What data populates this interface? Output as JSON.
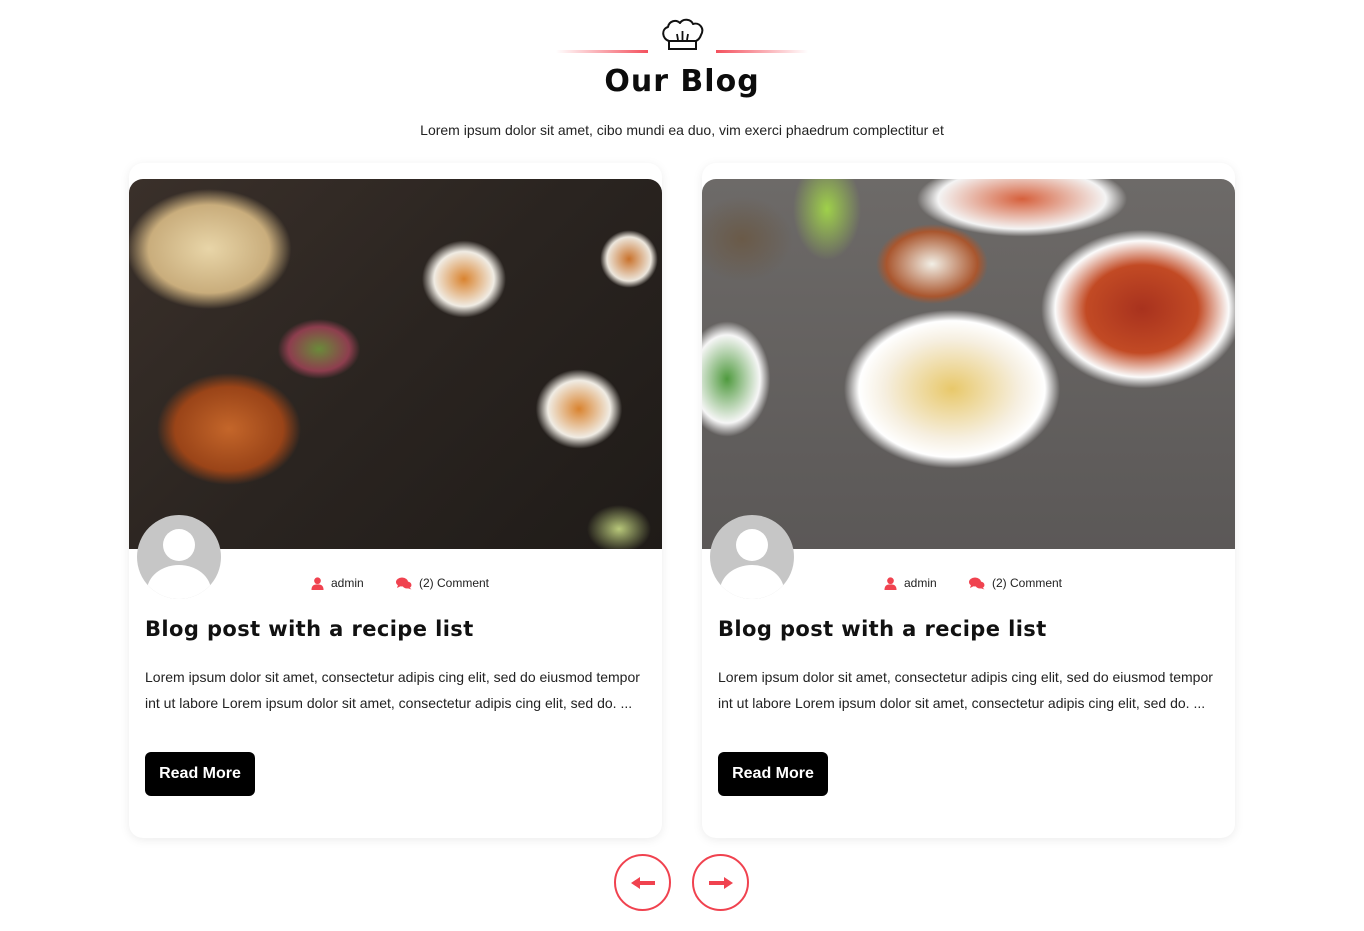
{
  "section": {
    "icon": "chef-hat-icon",
    "title": "Our Blog",
    "subtitle": "Lorem ipsum dolor sit amet, cibo mundi ea duo, vim exerci phaedrum complectitur et",
    "accent_color": "#f0424f"
  },
  "posts": [
    {
      "image": "indian-food-spread-with-naan-pakora-and-curries",
      "author_icon": "user-icon",
      "author": "admin",
      "comments_icon": "comments-icon",
      "comments": "(2) Comment",
      "title": "Blog post with a recipe list",
      "excerpt": "Lorem ipsum dolor sit amet, consectetur adipis cing elit, sed do eiusmod tempor int ut labore Lorem ipsum dolor sit amet, consectetur adipis cing elit, sed do. ...",
      "button_label": "Read More"
    },
    {
      "image": "biryani-rice-bowl-with-side-dishes",
      "author_icon": "user-icon",
      "author": "admin",
      "comments_icon": "comments-icon",
      "comments": "(2) Comment",
      "title": "Blog post with a recipe list",
      "excerpt": "Lorem ipsum dolor sit amet, consectetur adipis cing elit, sed do eiusmod tempor int ut labore Lorem ipsum dolor sit amet, consectetur adipis cing elit, sed do. ...",
      "button_label": "Read More"
    }
  ],
  "carousel": {
    "prev_icon": "arrow-left-icon",
    "next_icon": "arrow-right-icon"
  }
}
